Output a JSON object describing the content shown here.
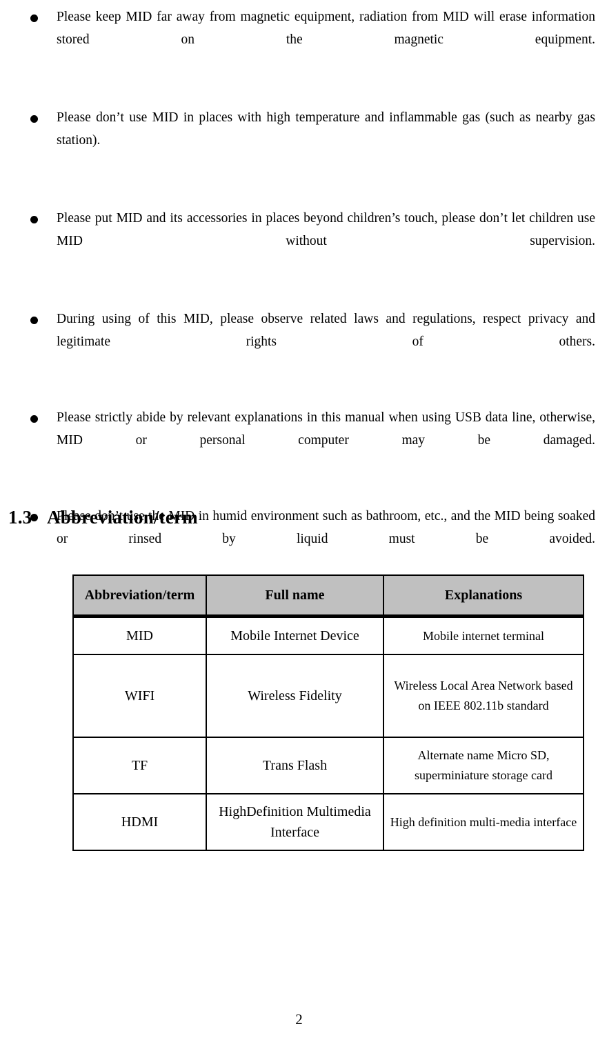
{
  "document": {
    "page_number": "2"
  },
  "safety_notes": {
    "bullet_glyph": "●",
    "items": [
      {
        "text": "Please keep MID far away from magnetic equipment, radiation from MID will erase information stored on the magnetic equipment."
      },
      {
        "text": "Please don’t use MID in places with high temperature and inflammable gas (such as nearby gas station)."
      },
      {
        "text": "Please put MID and its accessories in places beyond children’s touch, please don’t let children use MID without supervision."
      },
      {
        "text": "During using of this MID, please observe related laws and regulations, respect privacy and legitimate rights of others."
      },
      {
        "text": "Please strictly abide by relevant explanations in this manual when using USB data line, otherwise, MID or personal computer may be damaged."
      },
      {
        "text": "Please don’t use the MID in humid environment such as bathroom, etc., and the MID being soaked or rinsed by liquid must be avoided."
      }
    ]
  },
  "section": {
    "number": "1.3",
    "title": "Abbreviation/term"
  },
  "abbreviation_table": {
    "header_background": "#c0c0c0",
    "columns": [
      "Abbreviation/term",
      "Full name",
      "Explanations"
    ],
    "rows": [
      {
        "abbreviation": "MID",
        "full_name": "Mobile Internet Device",
        "explanation": "Mobile internet terminal"
      },
      {
        "abbreviation": "WIFI",
        "full_name": "Wireless Fidelity",
        "explanation": "Wireless Local Area Network based on IEEE 802.11b standard"
      },
      {
        "abbreviation": "TF",
        "full_name": "Trans Flash",
        "explanation": "Alternate name Micro SD, superminiature storage card"
      },
      {
        "abbreviation": "HDMI",
        "full_name": "HighDefinition Multimedia Interface",
        "explanation": "High definition multi-media interface"
      }
    ]
  }
}
